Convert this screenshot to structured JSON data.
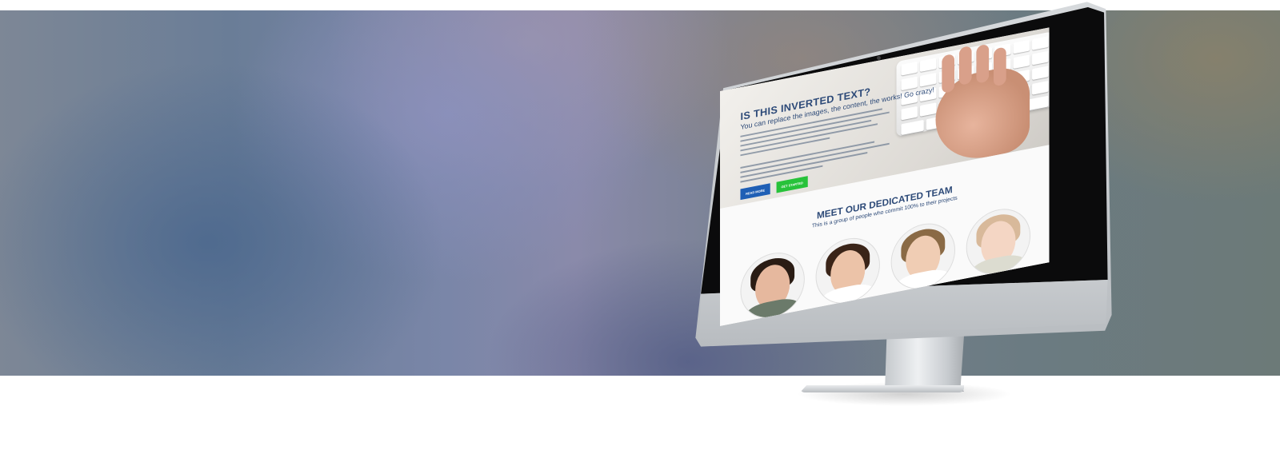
{
  "screen": {
    "hero_title": "IS THIS INVERTED TEXT?",
    "hero_subtitle": "You can replace the images, the content, the works! Go crazy!",
    "read_more_label": "READ MORE",
    "get_started_label": "GET STARTED",
    "team_title": "MEET OUR DEDICATED TEAM",
    "team_subtitle": "This is a group of people who commit 100% to their projects"
  },
  "team_members": [
    {
      "skin": "#e6b89e",
      "hair": "#2a1c14",
      "shirt": "#6b7a6a"
    },
    {
      "skin": "#ecc3a8",
      "hair": "#3a2418",
      "shirt": "#ffffff"
    },
    {
      "skin": "#f0cdb4",
      "hair": "#8a6a45",
      "shirt": "#ffffff"
    },
    {
      "skin": "#f4d6c4",
      "hair": "#d8b99a",
      "shirt": "#dcdcd0"
    }
  ],
  "colors": {
    "heading": "#2d4a78",
    "read_more_button": "#1f5fb5",
    "get_started_button": "#27c23a"
  },
  "icons": [
    "camera-icon"
  ]
}
